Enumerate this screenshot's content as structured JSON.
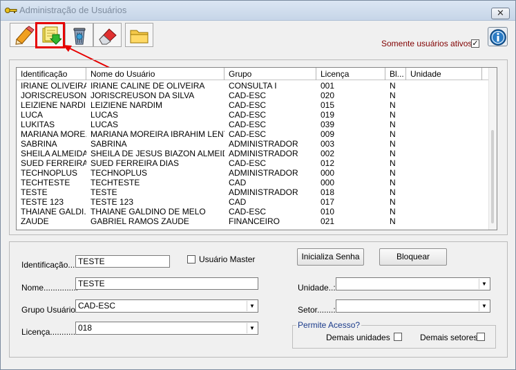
{
  "window": {
    "title": "Administração de Usuários",
    "close_label": "✕"
  },
  "toolbar": {
    "buttons": [
      {
        "name": "edit-button",
        "icon": "pencil-icon"
      },
      {
        "name": "export-button",
        "icon": "document-green-arrow-icon"
      },
      {
        "name": "delete-button",
        "icon": "recycle-bin-icon"
      },
      {
        "name": "eraser-button",
        "icon": "eraser-icon"
      },
      {
        "name": "open-folder-button",
        "icon": "folder-icon"
      }
    ],
    "active_only_label": "Somente usuários ativos?",
    "active_only_checked": "✓",
    "info_icon": "info-icon"
  },
  "grid": {
    "columns": [
      "Identificação",
      "Nome do Usuário",
      "Grupo",
      "Licença",
      "Bl...",
      "Unidade"
    ],
    "rows": [
      [
        "IRIANE OLIVEIRA",
        "IRIANE CALINE DE OLIVEIRA",
        "CONSULTA I",
        "001",
        "N"
      ],
      [
        "JORISCREUSON",
        "JORISCREUSON DA SILVA",
        "CAD-ESC",
        "020",
        "N"
      ],
      [
        "LEIZIENE NARDIM",
        "LEIZIENE NARDIM",
        "CAD-ESC",
        "015",
        "N"
      ],
      [
        "LUCA",
        "LUCAS",
        "CAD-ESC",
        "019",
        "N"
      ],
      [
        "LUKITAS",
        "LUCAS",
        "CAD-ESC",
        "039",
        "N"
      ],
      [
        "MARIANA MORE...",
        "MARIANA MOREIRA IBRAHIM LENTI",
        "CAD-ESC",
        "009",
        "N"
      ],
      [
        "SABRINA",
        "SABRINA",
        "ADMINISTRADOR",
        "003",
        "N"
      ],
      [
        "SHEILA ALMEIDA",
        "SHEILA DE JESUS BIAZON ALMEIDA",
        "ADMINISTRADOR",
        "002",
        "N"
      ],
      [
        "SUED FERREIRA",
        "SUED FERREIRA DIAS",
        "CAD-ESC",
        "012",
        "N"
      ],
      [
        "TECHNOPLUS",
        "TECHNOPLUS",
        "ADMINISTRADOR",
        "000",
        "N"
      ],
      [
        "TECHTESTE",
        "TECHTESTE",
        "CAD",
        "000",
        "N"
      ],
      [
        "TESTE",
        "TESTE",
        "ADMINISTRADOR",
        "018",
        "N"
      ],
      [
        "TESTE 123",
        "TESTE 123",
        "CAD",
        "017",
        "N"
      ],
      [
        "THAIANE GALDI...",
        "THAIANE GALDINO DE MELO",
        "CAD-ESC",
        "010",
        "N"
      ],
      [
        "ZAUDE",
        "GABRIEL RAMOS ZAUDE",
        "FINANCEIRO",
        "021",
        "N"
      ]
    ]
  },
  "form": {
    "identificacao_label": "Identificação...:",
    "identificacao_value": "TESTE",
    "usuario_master_label": "Usuário Master",
    "nome_label": "Nome..............:",
    "nome_value": "TESTE",
    "grupo_label": "Grupo Usuário:",
    "grupo_value": "CAD-ESC",
    "licenca_label": "Licença...........:",
    "licenca_value": "018",
    "inicializa_senha_label": "Inicializa Senha",
    "bloquear_label": "Bloquear",
    "unidade_label": "Unidade..:",
    "unidade_value": "",
    "setor_label": "Setor.......:",
    "setor_value": "",
    "permite_acesso_title": "Permite Acesso?",
    "demais_unidades_label": "Demais unidades",
    "demais_setores_label": "Demais setores"
  },
  "colors": {
    "highlight": "#e60000",
    "accent_label": "#800000",
    "group_title": "#1a3a8a"
  }
}
